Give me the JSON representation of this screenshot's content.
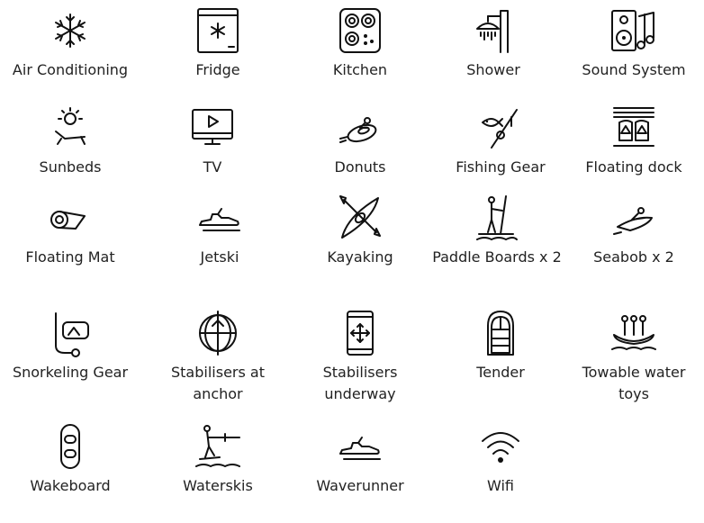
{
  "amenities": [
    {
      "label": "Air Conditioning",
      "icon": "snowflake-icon"
    },
    {
      "label": "Fridge",
      "icon": "fridge-icon"
    },
    {
      "label": "Kitchen",
      "icon": "stove-icon"
    },
    {
      "label": "Shower",
      "icon": "shower-icon"
    },
    {
      "label": "Sound System",
      "icon": "speaker-music-icon"
    },
    {
      "label": "Sunbeds",
      "icon": "sunbed-icon"
    },
    {
      "label": "TV",
      "icon": "tv-icon"
    },
    {
      "label": "Donuts",
      "icon": "donut-tube-icon"
    },
    {
      "label": "Fishing Gear",
      "icon": "fishing-rod-icon"
    },
    {
      "label": "Floating dock",
      "icon": "floating-dock-icon"
    },
    {
      "label": "Floating Mat",
      "icon": "floating-mat-icon"
    },
    {
      "label": "Jetski",
      "icon": "jetski-icon"
    },
    {
      "label": "Kayaking",
      "icon": "kayak-icon"
    },
    {
      "label": "Paddle Boards x 2",
      "icon": "paddle-board-icon"
    },
    {
      "label": "Seabob x 2",
      "icon": "seabob-icon"
    },
    {
      "label": "Snorkeling Gear",
      "icon": "snorkel-icon"
    },
    {
      "label": "Stabilisers at anchor",
      "icon": "stabiliser-anchor-icon"
    },
    {
      "label": "Stabilisers underway",
      "icon": "stabiliser-phone-icon"
    },
    {
      "label": "Tender",
      "icon": "tender-boat-icon"
    },
    {
      "label": "Towable water toys",
      "icon": "towable-toy-icon"
    },
    {
      "label": "Wakeboard",
      "icon": "wakeboard-icon"
    },
    {
      "label": "Waterskis",
      "icon": "waterski-icon"
    },
    {
      "label": "Waverunner",
      "icon": "waverunner-icon"
    },
    {
      "label": "Wifi",
      "icon": "wifi-icon"
    }
  ]
}
